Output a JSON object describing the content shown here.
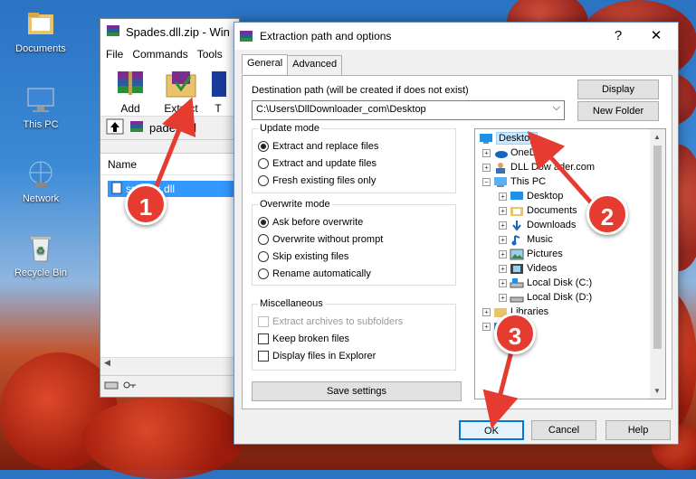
{
  "desktop": {
    "icons": [
      {
        "label": "Documents",
        "icon": "folder-icon"
      },
      {
        "label": "This PC",
        "icon": "computer-icon"
      },
      {
        "label": "Network",
        "icon": "network-icon"
      },
      {
        "label": "Recycle Bin",
        "icon": "recycle-bin-icon"
      }
    ]
  },
  "winrar": {
    "title": "Spades.dll.zip - Win",
    "menu": [
      "File",
      "Commands",
      "Tools"
    ],
    "tools": [
      {
        "label": "Add"
      },
      {
        "label": "Extract To"
      },
      {
        "label": "T"
      }
    ],
    "path": "pades.dll",
    "column_name": "Name",
    "file": "spades.dll"
  },
  "dialog": {
    "title": "Extraction path and options",
    "help": "?",
    "close": "✕",
    "tabs": [
      "General",
      "Advanced"
    ],
    "dest_label": "Destination path (will be created if does not exist)",
    "dest_value": "C:\\Users\\DllDownloader_com\\Desktop",
    "display_btn": "Display",
    "new_folder_btn": "New Folder",
    "update_mode": {
      "legend": "Update mode",
      "options": [
        "Extract and replace files",
        "Extract and update files",
        "Fresh existing files only"
      ],
      "selected": 0
    },
    "overwrite_mode": {
      "legend": "Overwrite mode",
      "options": [
        "Ask before overwrite",
        "Overwrite without prompt",
        "Skip existing files",
        "Rename automatically"
      ],
      "selected": 0
    },
    "misc": {
      "legend": "Miscellaneous",
      "options": [
        "Extract archives to subfolders",
        "Keep broken files",
        "Display files in Explorer"
      ]
    },
    "save_settings": "Save settings",
    "tree": {
      "desktop": "Desktop",
      "onedrive": "OneDri",
      "dll": "DLL Dow",
      "dll_tail": "ader.com",
      "thispc": "This PC",
      "children": [
        "Desktop",
        "Documents",
        "Downloads",
        "Music",
        "Pictures",
        "Videos",
        "Local Disk (C:)",
        "Local Disk (D:)"
      ],
      "libraries": "Libraries",
      "network": "ork"
    },
    "ok": "OK",
    "cancel": "Cancel",
    "help_btn": "Help"
  },
  "annotations": [
    "1",
    "2",
    "3"
  ],
  "colors": {
    "accent": "#0078d7",
    "badge": "#e53b30",
    "selection": "#3399ff"
  }
}
